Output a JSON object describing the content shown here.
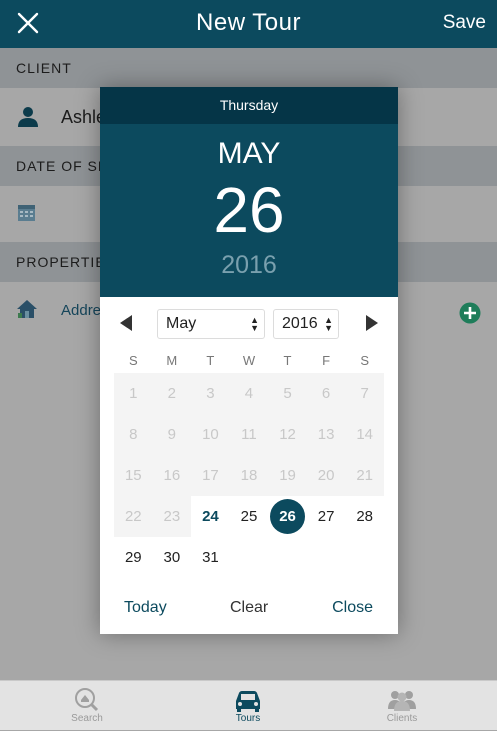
{
  "header": {
    "title": "New Tour",
    "save_label": "Save"
  },
  "form": {
    "client_heading": "CLIENT",
    "client_name": "Ashle",
    "date_heading": "DATE OF SH",
    "properties_heading": "PROPERTIE",
    "address_placeholder": "Addre"
  },
  "picker": {
    "weekday": "Thursday",
    "month": "MAY",
    "day": "26",
    "year": "2016",
    "selected_month": "May",
    "selected_year": "2016",
    "weekday_headers": [
      "S",
      "M",
      "T",
      "W",
      "T",
      "F",
      "S"
    ],
    "weeks": [
      [
        "1",
        "2",
        "3",
        "4",
        "5",
        "6",
        "7"
      ],
      [
        "8",
        "9",
        "10",
        "11",
        "12",
        "13",
        "14"
      ],
      [
        "15",
        "16",
        "17",
        "18",
        "19",
        "20",
        "21"
      ],
      [
        "22",
        "23",
        "24",
        "25",
        "26",
        "27",
        "28"
      ],
      [
        "29",
        "30",
        "31",
        "",
        "",
        "",
        ""
      ]
    ],
    "disabled_through": 23,
    "today_day": "24",
    "selected_day": "26",
    "today_label": "Today",
    "clear_label": "Clear",
    "close_label": "Close"
  },
  "tabs": [
    {
      "label": "Search",
      "icon": "search-icon",
      "active": false
    },
    {
      "label": "Tours",
      "icon": "car-icon",
      "active": true
    },
    {
      "label": "Clients",
      "icon": "clients-icon",
      "active": false
    }
  ],
  "colors": {
    "primary": "#0c4a5e",
    "dark": "#053547",
    "accent_green": "#1e9d6d"
  }
}
